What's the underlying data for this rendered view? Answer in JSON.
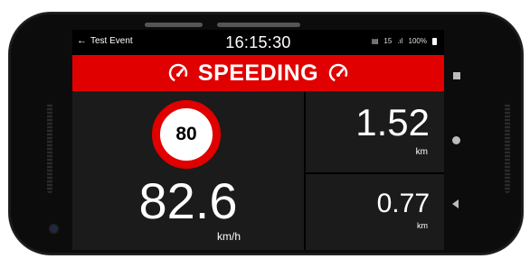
{
  "statusbar": {
    "back_label": "Test Event",
    "time": "16:15:30",
    "notification_count": "15",
    "battery": "100%"
  },
  "alert": {
    "label": "SPEEDING",
    "color": "#e00000"
  },
  "speed_limit": {
    "value": "80"
  },
  "speed": {
    "value": "82.6",
    "unit": "km/h"
  },
  "distance_primary": {
    "value": "1.52",
    "unit": "km"
  },
  "distance_secondary": {
    "value": "0.77",
    "unit": "km"
  },
  "icons": {
    "back": "arrow-left-icon",
    "gauge": "speedometer-icon",
    "notification": "notification-icon",
    "signal": "signal-icon",
    "battery": "battery-icon",
    "nav_recents": "square-icon",
    "nav_home": "circle-icon",
    "nav_back": "triangle-icon"
  }
}
